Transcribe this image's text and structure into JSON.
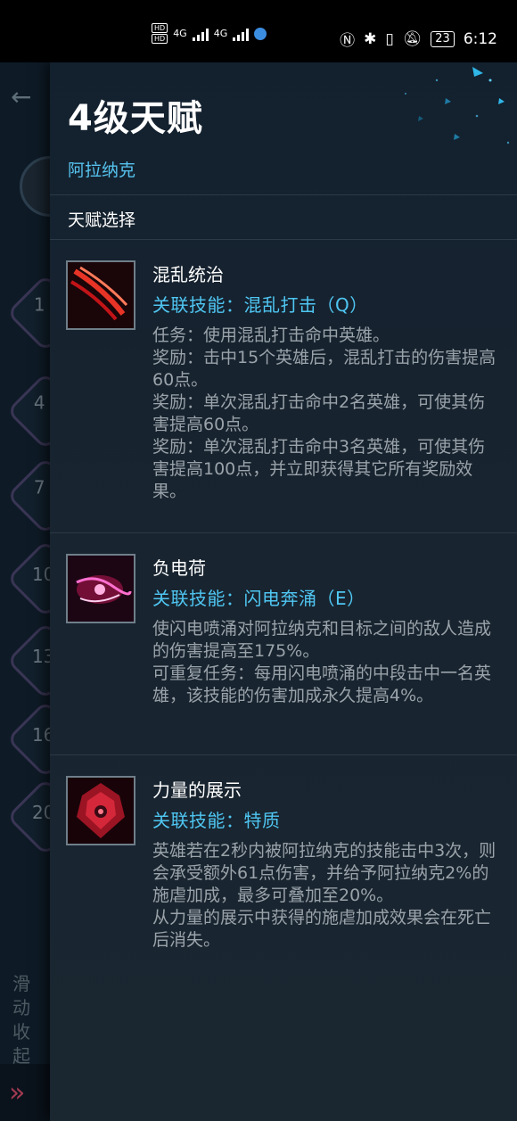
{
  "status_bar": {
    "network_label_1": "4G",
    "network_label_2": "4G",
    "hd_1": "HD",
    "hd_2": "HD",
    "battery": "23",
    "time": "6:12"
  },
  "background": {
    "levels": [
      "1",
      "4",
      "7",
      "10",
      "13",
      "16",
      "20"
    ],
    "side_text": "滑动收起"
  },
  "panel": {
    "title": "4级天赋",
    "hero_name": "阿拉纳克",
    "section_label": "天赋选择",
    "talents": [
      {
        "name": "混乱统治",
        "skill": "关联技能：混乱打击（Q）",
        "desc": [
          "任务：使用混乱打击命中英雄。",
          "奖励：击中15个英雄后，混乱打击的伤害提高60点。",
          "奖励：单次混乱打击命中2名英雄，可使其伤害提高60点。",
          "奖励：单次混乱打击命中3名英雄，可使其伤害提高100点，并立即获得其它所有奖励效果。"
        ],
        "icon": "red-slash-icon"
      },
      {
        "name": "负电荷",
        "skill": "关联技能：闪电奔涌（E）",
        "desc": [
          "使闪电喷涌对阿拉纳克和目标之间的敌人造成的伤害提高至175%。",
          "可重复任务：每用闪电喷涌的中段击中一名英雄，该技能的伤害加成永久提高4%。"
        ],
        "icon": "lightning-hand-icon"
      },
      {
        "name": "力量的展示",
        "skill": "关联技能：特质",
        "desc": [
          "英雄若在2秒内被阿拉纳克的技能击中3次，则会承受额外61点伤害，并给予阿拉纳克2%的施虐加成，最多可叠加至20%。",
          "从力量的展示中获得的施虐加成效果会在死亡后消失。"
        ],
        "icon": "crimson-crest-icon"
      }
    ]
  },
  "colors": {
    "accent_blue": "#56c3ef",
    "panel_bg": "#17232f",
    "text_gray": "#9aa3aa"
  }
}
